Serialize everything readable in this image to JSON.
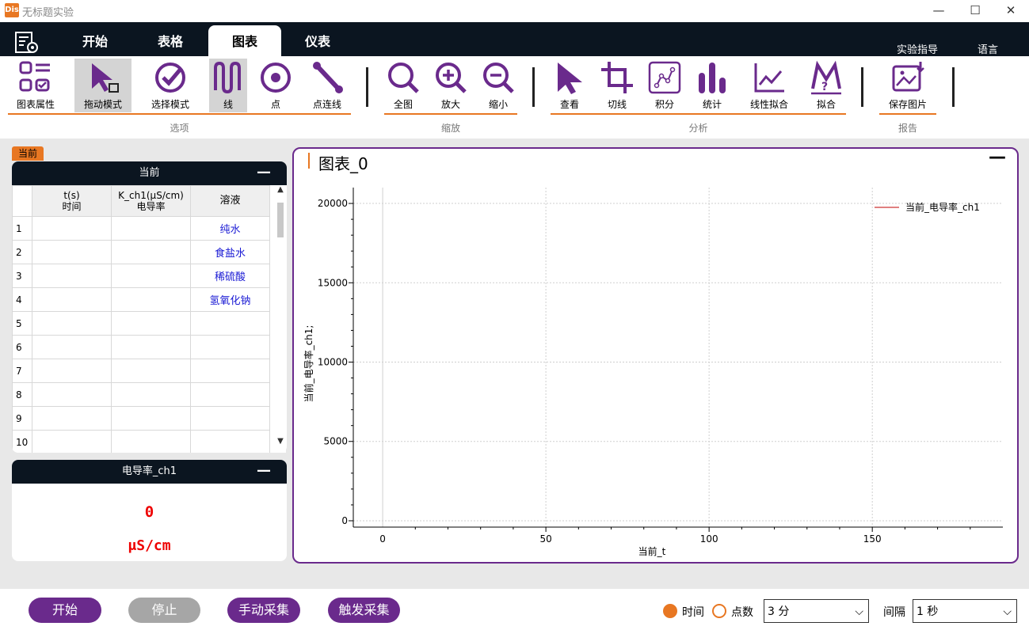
{
  "window": {
    "logo_text": "Dis",
    "title": "无标题实验",
    "controls": {
      "minimize": "—",
      "maximize": "☐",
      "close": "✕"
    }
  },
  "menu": {
    "tabs": [
      {
        "label": "开始",
        "active": false
      },
      {
        "label": "表格",
        "active": false
      },
      {
        "label": "图表",
        "active": true
      },
      {
        "label": "仪表",
        "active": false
      }
    ],
    "right": {
      "guide": "实验指导",
      "language": "语言"
    }
  },
  "ribbon": {
    "groups": [
      {
        "label": "选项",
        "tools": [
          "图表属性",
          "拖动模式",
          "选择模式",
          "线",
          "点",
          "点连线"
        ]
      },
      {
        "label": "缩放",
        "tools": [
          "全图",
          "放大",
          "缩小"
        ]
      },
      {
        "label": "分析",
        "tools": [
          "查看",
          "切线",
          "积分",
          "统计",
          "线性拟合",
          "拟合"
        ]
      },
      {
        "label": "报告",
        "tools": [
          "保存图片"
        ]
      }
    ],
    "selected_tools": [
      "拖动模式",
      "线"
    ],
    "accent_color": "#6a2a8c",
    "group_line_color": "#e87722"
  },
  "data_table": {
    "tag": "当前",
    "title": "当前",
    "minimize": "—",
    "columns": [
      {
        "line1": "t(s)",
        "line2": "时间"
      },
      {
        "line1": "K_ch1(μS/cm)",
        "line2": "电导率"
      },
      {
        "line1": "溶液",
        "line2": ""
      }
    ],
    "rows": [
      {
        "n": "1",
        "t": "",
        "k": "",
        "solution": "纯水"
      },
      {
        "n": "2",
        "t": "",
        "k": "",
        "solution": "食盐水"
      },
      {
        "n": "3",
        "t": "",
        "k": "",
        "solution": "稀硫酸"
      },
      {
        "n": "4",
        "t": "",
        "k": "",
        "solution": "氢氧化钠"
      },
      {
        "n": "5",
        "t": "",
        "k": "",
        "solution": ""
      },
      {
        "n": "6",
        "t": "",
        "k": "",
        "solution": ""
      },
      {
        "n": "7",
        "t": "",
        "k": "",
        "solution": ""
      },
      {
        "n": "8",
        "t": "",
        "k": "",
        "solution": ""
      },
      {
        "n": "9",
        "t": "",
        "k": "",
        "solution": ""
      },
      {
        "n": "10",
        "t": "",
        "k": "",
        "solution": ""
      }
    ]
  },
  "meter": {
    "title": "电导率_ch1",
    "minimize": "—",
    "value": "0",
    "unit": "μS/cm"
  },
  "chart_panel": {
    "title": "图表_0",
    "minimize": "—"
  },
  "chart_data": {
    "type": "line",
    "title": "",
    "xlabel": "当前_t",
    "ylabel": "当前_电导率_ch1;",
    "xlim": [
      -9,
      190
    ],
    "ylim": [
      -400,
      21000
    ],
    "x_ticks": [
      0,
      50,
      100,
      150
    ],
    "y_ticks": [
      0,
      5000,
      10000,
      15000,
      20000
    ],
    "grid": true,
    "legend_position": "top-right",
    "series": [
      {
        "name": "当前_电导率_ch1",
        "color": "#c00000",
        "x": [],
        "y": []
      }
    ]
  },
  "bottom": {
    "buttons": {
      "start": "开始",
      "stop": "停止",
      "manual": "手动采集",
      "trigger": "触发采集"
    },
    "mode_time": "时间",
    "mode_points": "点数",
    "duration": "3 分",
    "interval_label": "间隔",
    "interval": "1 秒",
    "colors": {
      "primary": "#6a2a8c",
      "disabled": "#a6a6a6",
      "radio": "#e87722"
    }
  }
}
